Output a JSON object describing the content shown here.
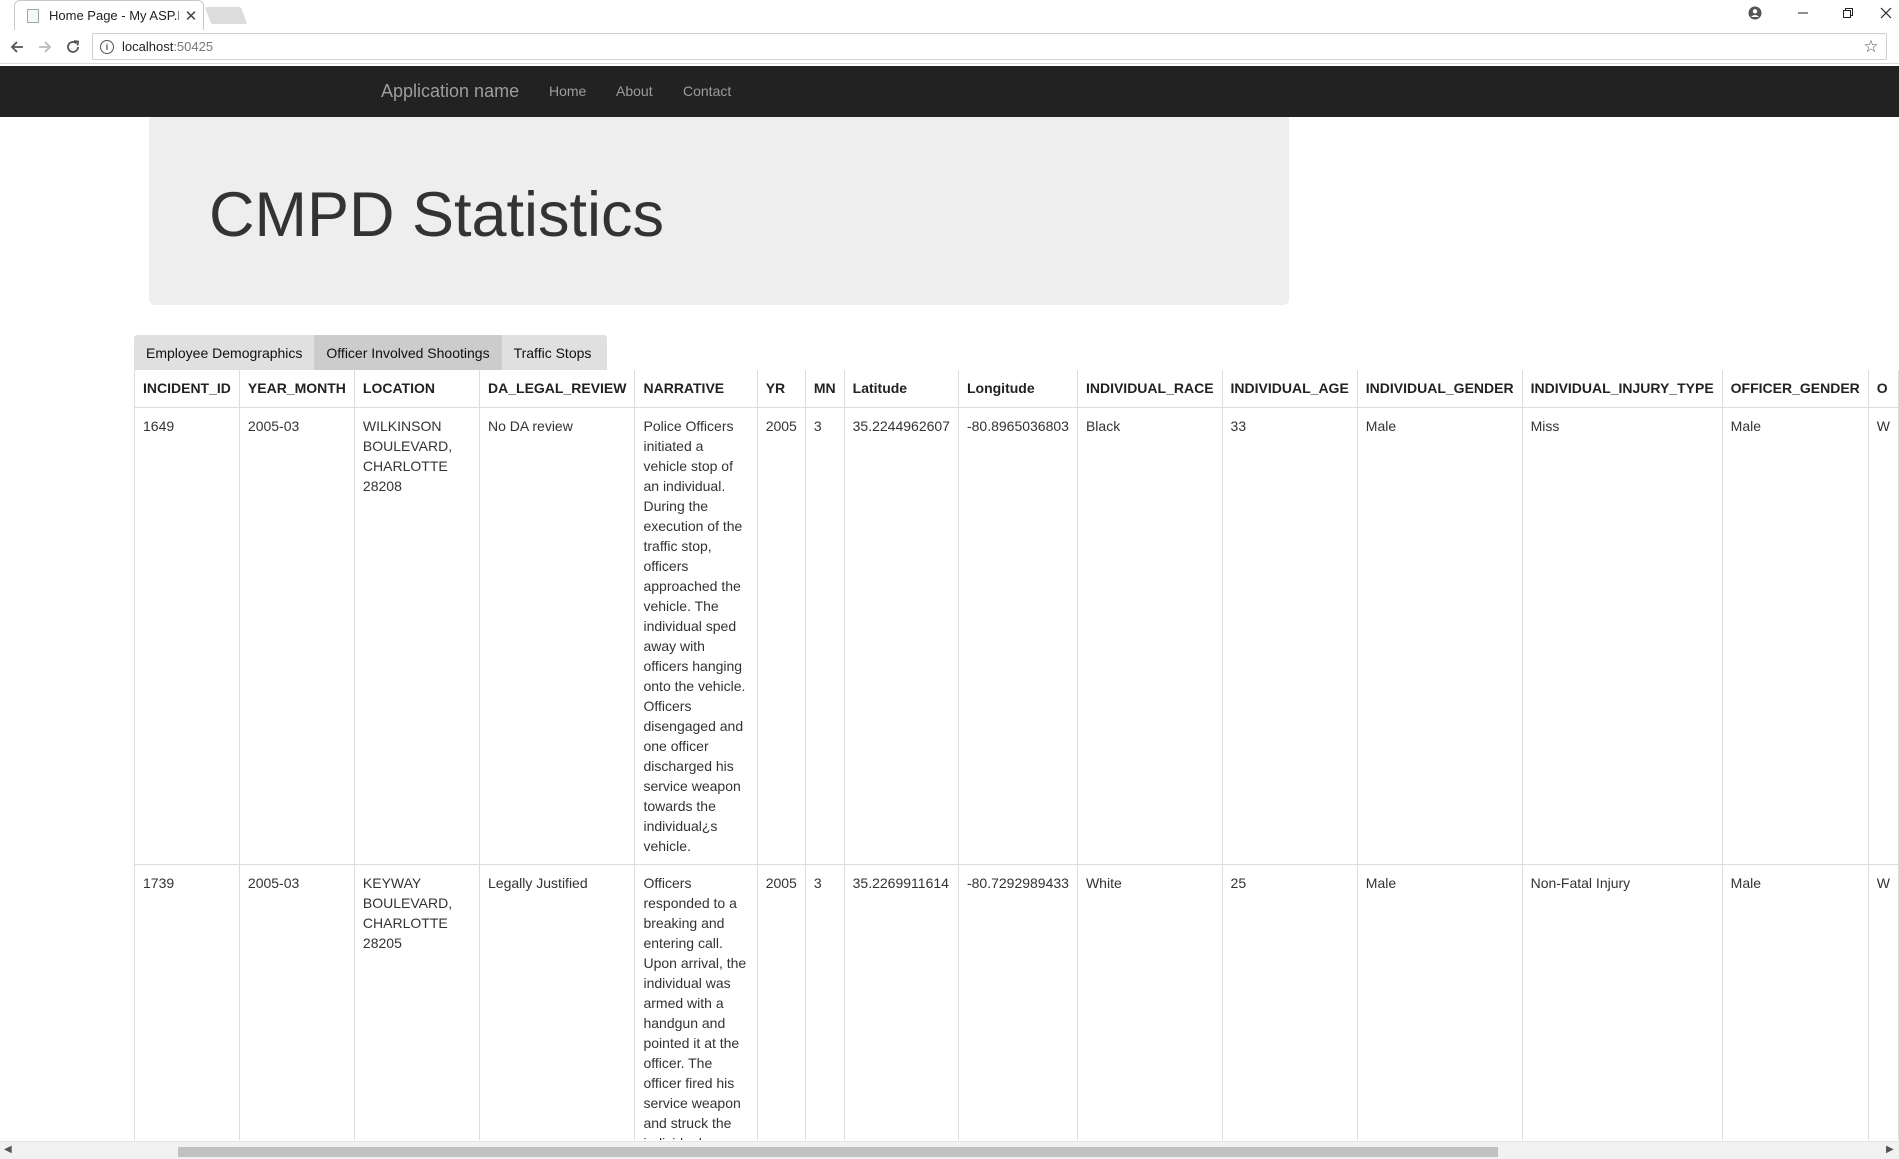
{
  "browser": {
    "tab_title": "Home Page - My ASP.NE",
    "tab_close": "✕",
    "url_host": "localhost",
    "url_port": ":50425",
    "icons": {
      "back": "arrow-left",
      "forward": "arrow-right",
      "reload": "reload",
      "info": "info",
      "star": "star",
      "account": "account",
      "minimize": "minimize",
      "restore": "restore",
      "close": "close"
    }
  },
  "navbar": {
    "brand": "Application name",
    "links": [
      "Home",
      "About",
      "Contact"
    ]
  },
  "jumbotron": {
    "title": "CMPD Statistics"
  },
  "tabs": [
    "Employee Demographics",
    "Officer Involved Shootings",
    "Traffic Stops"
  ],
  "table": {
    "columns": [
      "INCIDENT_ID",
      "YEAR_MONTH",
      "LOCATION",
      "DA_LEGAL_REVIEW",
      "NARRATIVE",
      "YR",
      "MN",
      "Latitude",
      "Longitude",
      "INDIVIDUAL_RACE",
      "INDIVIDUAL_AGE",
      "INDIVIDUAL_GENDER",
      "INDIVIDUAL_INJURY_TYPE",
      "OFFICER_GENDER",
      "O"
    ],
    "rows": [
      [
        "1649",
        "2005-03",
        "WILKINSON BOULEVARD, CHARLOTTE 28208",
        "No DA review",
        "Police Officers initiated a vehicle stop of an individual. During the execution of the traffic stop, officers approached the vehicle. The individual sped away with officers hanging onto the vehicle. Officers disengaged and one officer discharged his service weapon towards the individual¿s vehicle.",
        "2005",
        "3",
        "35.2244962607",
        "-80.8965036803",
        "Black",
        "33",
        "Male",
        "Miss",
        "Male",
        "W"
      ],
      [
        "1739",
        "2005-03",
        "KEYWAY BOULEVARD, CHARLOTTE 28205",
        "Legally Justified",
        "Officers responded to a breaking and entering call. Upon arrival, the individual was armed with a handgun and pointed it at the officer. The officer fired his service weapon and struck the individual.",
        "2005",
        "3",
        "35.2269911614",
        "-80.7292989433",
        "White",
        "25",
        "Male",
        "Non-Fatal Injury",
        "Male",
        "W"
      ]
    ]
  }
}
